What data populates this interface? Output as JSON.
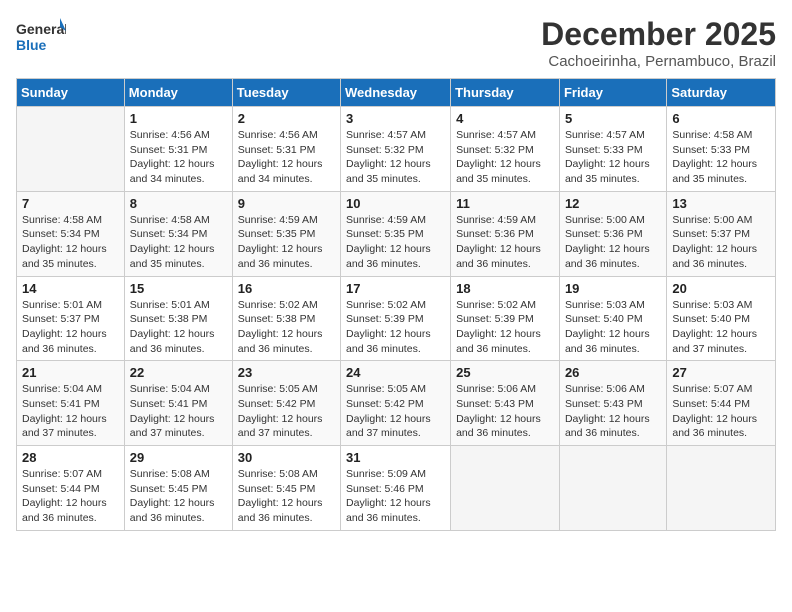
{
  "logo": {
    "line1": "General",
    "line2": "Blue"
  },
  "title": "December 2025",
  "subtitle": "Cachoeirinha, Pernambuco, Brazil",
  "days_of_week": [
    "Sunday",
    "Monday",
    "Tuesday",
    "Wednesday",
    "Thursday",
    "Friday",
    "Saturday"
  ],
  "weeks": [
    [
      {
        "day": "",
        "info": ""
      },
      {
        "day": "1",
        "info": "Sunrise: 4:56 AM\nSunset: 5:31 PM\nDaylight: 12 hours\nand 34 minutes."
      },
      {
        "day": "2",
        "info": "Sunrise: 4:56 AM\nSunset: 5:31 PM\nDaylight: 12 hours\nand 34 minutes."
      },
      {
        "day": "3",
        "info": "Sunrise: 4:57 AM\nSunset: 5:32 PM\nDaylight: 12 hours\nand 35 minutes."
      },
      {
        "day": "4",
        "info": "Sunrise: 4:57 AM\nSunset: 5:32 PM\nDaylight: 12 hours\nand 35 minutes."
      },
      {
        "day": "5",
        "info": "Sunrise: 4:57 AM\nSunset: 5:33 PM\nDaylight: 12 hours\nand 35 minutes."
      },
      {
        "day": "6",
        "info": "Sunrise: 4:58 AM\nSunset: 5:33 PM\nDaylight: 12 hours\nand 35 minutes."
      }
    ],
    [
      {
        "day": "7",
        "info": "Sunrise: 4:58 AM\nSunset: 5:34 PM\nDaylight: 12 hours\nand 35 minutes."
      },
      {
        "day": "8",
        "info": "Sunrise: 4:58 AM\nSunset: 5:34 PM\nDaylight: 12 hours\nand 35 minutes."
      },
      {
        "day": "9",
        "info": "Sunrise: 4:59 AM\nSunset: 5:35 PM\nDaylight: 12 hours\nand 36 minutes."
      },
      {
        "day": "10",
        "info": "Sunrise: 4:59 AM\nSunset: 5:35 PM\nDaylight: 12 hours\nand 36 minutes."
      },
      {
        "day": "11",
        "info": "Sunrise: 4:59 AM\nSunset: 5:36 PM\nDaylight: 12 hours\nand 36 minutes."
      },
      {
        "day": "12",
        "info": "Sunrise: 5:00 AM\nSunset: 5:36 PM\nDaylight: 12 hours\nand 36 minutes."
      },
      {
        "day": "13",
        "info": "Sunrise: 5:00 AM\nSunset: 5:37 PM\nDaylight: 12 hours\nand 36 minutes."
      }
    ],
    [
      {
        "day": "14",
        "info": "Sunrise: 5:01 AM\nSunset: 5:37 PM\nDaylight: 12 hours\nand 36 minutes."
      },
      {
        "day": "15",
        "info": "Sunrise: 5:01 AM\nSunset: 5:38 PM\nDaylight: 12 hours\nand 36 minutes."
      },
      {
        "day": "16",
        "info": "Sunrise: 5:02 AM\nSunset: 5:38 PM\nDaylight: 12 hours\nand 36 minutes."
      },
      {
        "day": "17",
        "info": "Sunrise: 5:02 AM\nSunset: 5:39 PM\nDaylight: 12 hours\nand 36 minutes."
      },
      {
        "day": "18",
        "info": "Sunrise: 5:02 AM\nSunset: 5:39 PM\nDaylight: 12 hours\nand 36 minutes."
      },
      {
        "day": "19",
        "info": "Sunrise: 5:03 AM\nSunset: 5:40 PM\nDaylight: 12 hours\nand 36 minutes."
      },
      {
        "day": "20",
        "info": "Sunrise: 5:03 AM\nSunset: 5:40 PM\nDaylight: 12 hours\nand 37 minutes."
      }
    ],
    [
      {
        "day": "21",
        "info": "Sunrise: 5:04 AM\nSunset: 5:41 PM\nDaylight: 12 hours\nand 37 minutes."
      },
      {
        "day": "22",
        "info": "Sunrise: 5:04 AM\nSunset: 5:41 PM\nDaylight: 12 hours\nand 37 minutes."
      },
      {
        "day": "23",
        "info": "Sunrise: 5:05 AM\nSunset: 5:42 PM\nDaylight: 12 hours\nand 37 minutes."
      },
      {
        "day": "24",
        "info": "Sunrise: 5:05 AM\nSunset: 5:42 PM\nDaylight: 12 hours\nand 37 minutes."
      },
      {
        "day": "25",
        "info": "Sunrise: 5:06 AM\nSunset: 5:43 PM\nDaylight: 12 hours\nand 36 minutes."
      },
      {
        "day": "26",
        "info": "Sunrise: 5:06 AM\nSunset: 5:43 PM\nDaylight: 12 hours\nand 36 minutes."
      },
      {
        "day": "27",
        "info": "Sunrise: 5:07 AM\nSunset: 5:44 PM\nDaylight: 12 hours\nand 36 minutes."
      }
    ],
    [
      {
        "day": "28",
        "info": "Sunrise: 5:07 AM\nSunset: 5:44 PM\nDaylight: 12 hours\nand 36 minutes."
      },
      {
        "day": "29",
        "info": "Sunrise: 5:08 AM\nSunset: 5:45 PM\nDaylight: 12 hours\nand 36 minutes."
      },
      {
        "day": "30",
        "info": "Sunrise: 5:08 AM\nSunset: 5:45 PM\nDaylight: 12 hours\nand 36 minutes."
      },
      {
        "day": "31",
        "info": "Sunrise: 5:09 AM\nSunset: 5:46 PM\nDaylight: 12 hours\nand 36 minutes."
      },
      {
        "day": "",
        "info": ""
      },
      {
        "day": "",
        "info": ""
      },
      {
        "day": "",
        "info": ""
      }
    ]
  ]
}
